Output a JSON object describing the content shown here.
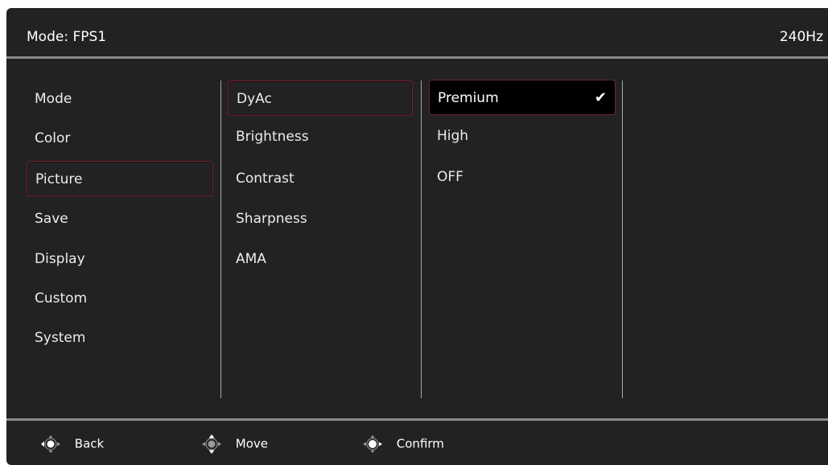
{
  "header": {
    "mode_label": "Mode: FPS1",
    "refresh_rate": "240Hz"
  },
  "main_menu": {
    "items": [
      {
        "label": "Mode"
      },
      {
        "label": "Color"
      },
      {
        "label": "Picture"
      },
      {
        "label": "Save"
      },
      {
        "label": "Display"
      },
      {
        "label": "Custom"
      },
      {
        "label": "System"
      }
    ],
    "selected": "Picture"
  },
  "sub_menu": {
    "items": [
      {
        "label": "DyAc"
      },
      {
        "label": "Brightness"
      },
      {
        "label": "Contrast"
      },
      {
        "label": "Sharpness"
      },
      {
        "label": "AMA"
      }
    ],
    "selected": "DyAc"
  },
  "options": {
    "items": [
      {
        "label": "Premium",
        "checked": true
      },
      {
        "label": "High",
        "checked": false
      },
      {
        "label": "OFF",
        "checked": false
      }
    ],
    "selected": "Premium",
    "check_icon": "checkmark-icon"
  },
  "footer": {
    "back_label": "Back",
    "move_label": "Move",
    "confirm_label": "Confirm",
    "back_icon": "joystick-left-icon",
    "move_icon": "joystick-updown-icon",
    "confirm_icon": "joystick-press-icon"
  },
  "colors": {
    "panel_bg": "#222224",
    "divider": "#8a8a8c",
    "selection_border": "#6a2430",
    "highlight_bg": "#000000",
    "text": "#ececec"
  }
}
